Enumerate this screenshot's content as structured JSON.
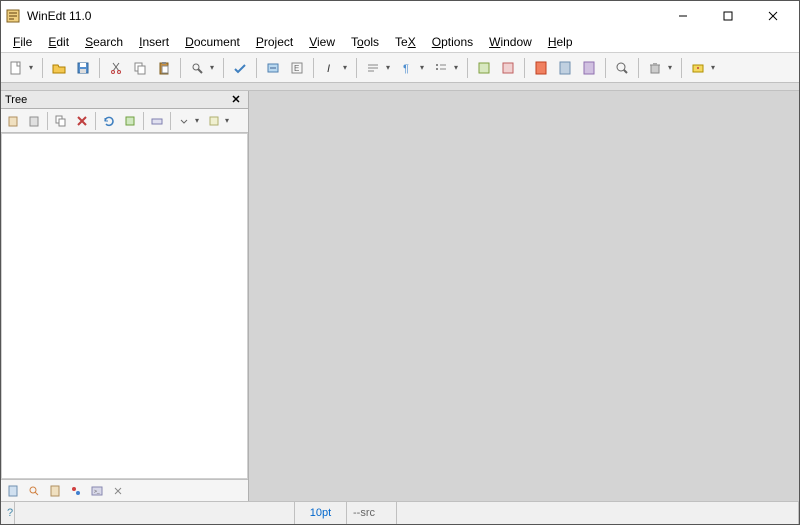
{
  "window": {
    "title": "WinEdt 11.0"
  },
  "menus": {
    "file": "File",
    "edit": "Edit",
    "search": "Search",
    "insert": "Insert",
    "document": "Document",
    "project": "Project",
    "view": "View",
    "tools": "Tools",
    "tex": "TeX",
    "options": "Options",
    "window": "Window",
    "help": "Help"
  },
  "tree": {
    "title": "Tree"
  },
  "status": {
    "help": "?",
    "fontsize": "10pt",
    "src": "--src"
  }
}
